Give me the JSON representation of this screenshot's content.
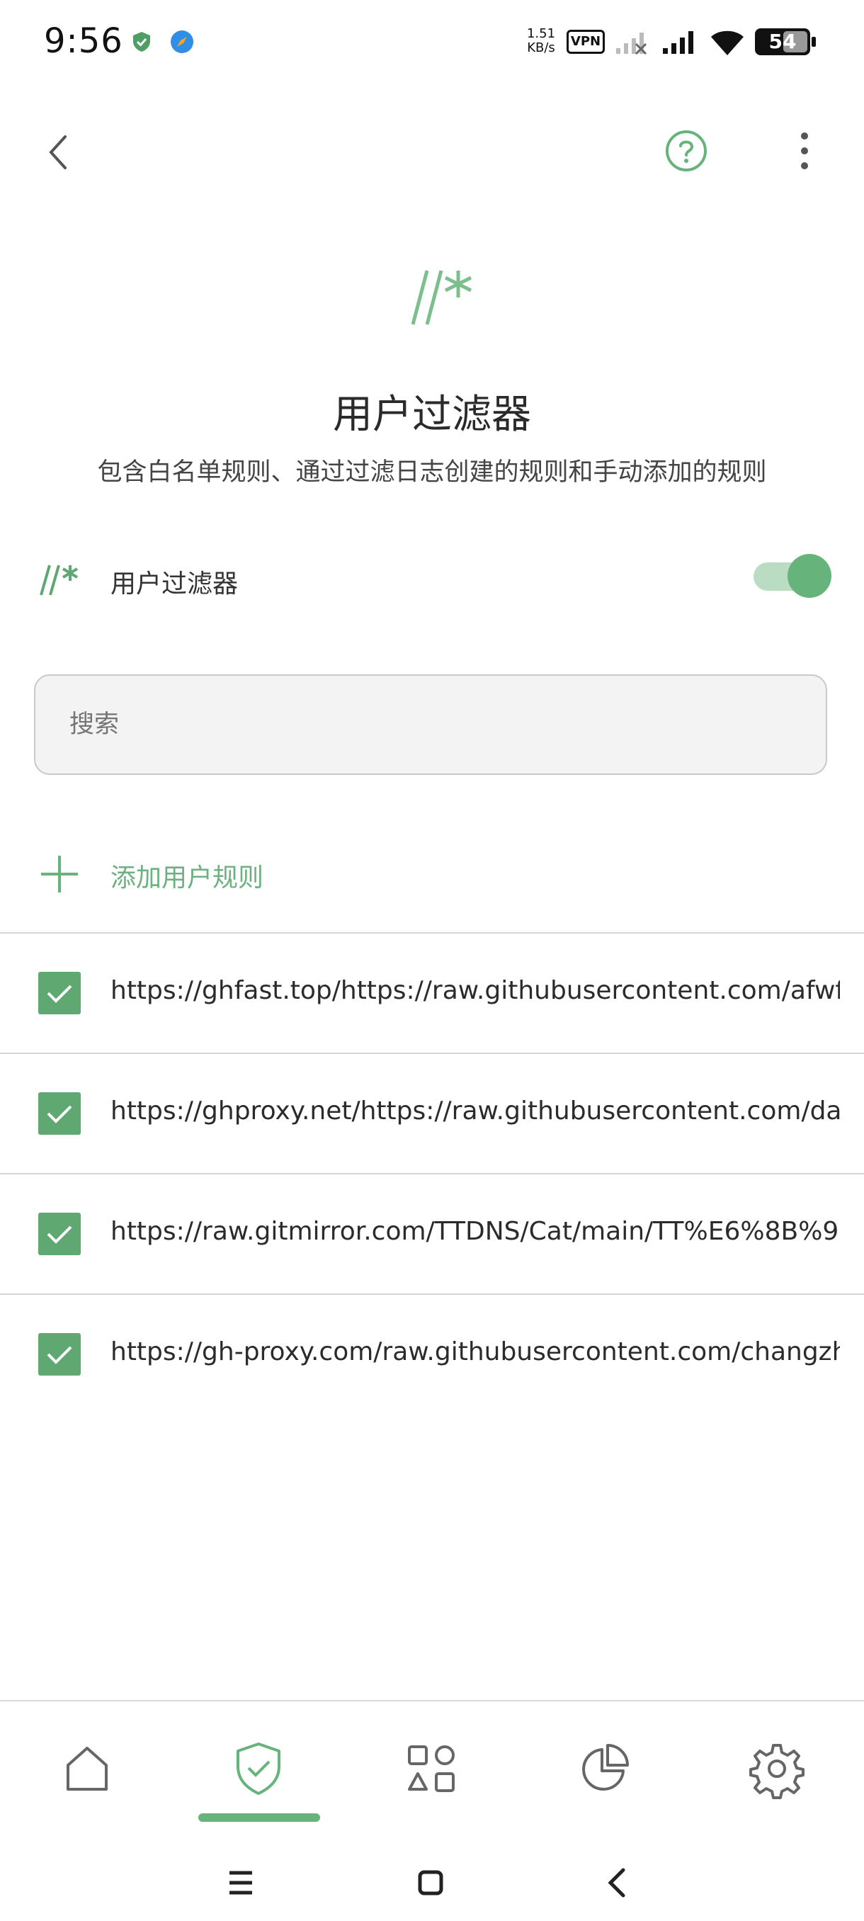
{
  "status_bar": {
    "time": "9:56",
    "net_speed_value": "1.51",
    "net_speed_unit": "KB/s",
    "vpn_label": "VPN",
    "battery": "54"
  },
  "header": {
    "back_icon": "chevron-left-icon",
    "help_icon": "help-circle-icon",
    "menu_icon": "more-vert-icon"
  },
  "hero": {
    "icon_glyph": "//*",
    "title": "用户过滤器",
    "description": "包含白名单规则、通过过滤日志创建的规则和手动添加的规则"
  },
  "filter_toggle": {
    "icon_glyph": "//*",
    "label": "用户过滤器",
    "enabled": true
  },
  "search": {
    "placeholder": "搜索"
  },
  "add_rule": {
    "label": "添加用户规则"
  },
  "rules": [
    {
      "text": "https://ghfast.top/https://raw.githubusercontent.com/afwfv...",
      "checked": true
    },
    {
      "text": "https://ghproxy.net/https://raw.githubusercontent.com/dam...",
      "checked": true
    },
    {
      "text": "https://raw.gitmirror.com/TTDNS/Cat/main/TT%E6%8B%9...",
      "checked": true
    },
    {
      "text": "https://gh-proxy.com/raw.githubusercontent.com/changzh...",
      "checked": true
    }
  ],
  "bottom_nav": {
    "items": [
      "home-icon",
      "shield-check-icon",
      "apps-icon",
      "pie-chart-icon",
      "settings-icon"
    ],
    "active_index": 1
  },
  "colors": {
    "accent": "#66b47b",
    "accent_dark": "#5fa872",
    "toggle_track": "#b9dcc3"
  }
}
